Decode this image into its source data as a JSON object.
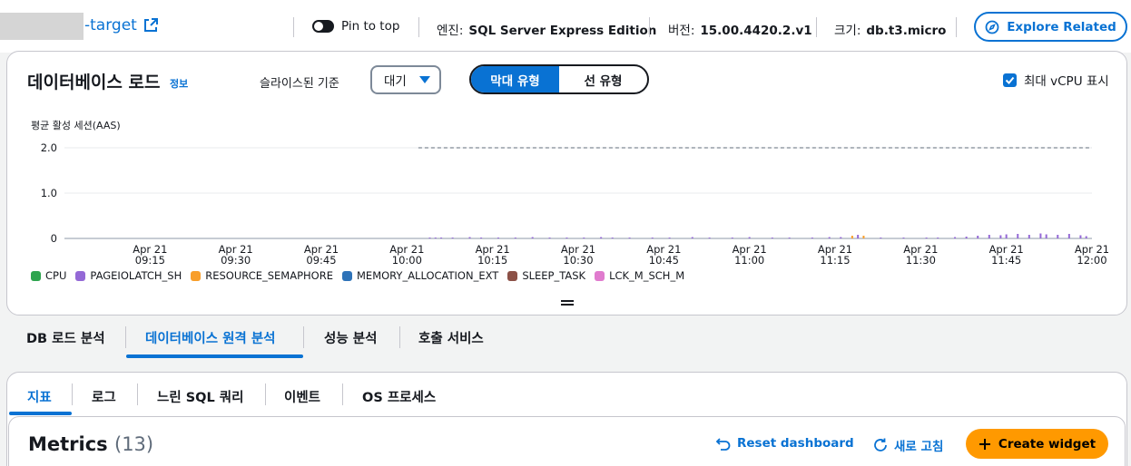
{
  "header": {
    "db_name": "-target",
    "pin_label": "Pin to top",
    "engine_label": "엔진:",
    "engine_value": "SQL Server Express Edition",
    "version_label": "버전:",
    "version_value": "15.00.4420.2.v1",
    "size_label": "크기:",
    "size_value": "db.t3.micro",
    "explore_label": "Explore Related"
  },
  "load_panel": {
    "title": "데이터베이스 로드",
    "info": "정보",
    "slice_label": "슬라이스된 기준",
    "slice_value": "대기",
    "seg_bar": "막대 유형",
    "seg_line": "선 유형",
    "vcpu_label": "최대 vCPU 표시",
    "vcpu_checked": true,
    "y_title": "평균 활성 세션(AAS)"
  },
  "chart_data": {
    "type": "bar",
    "ylabel": "평균 활성 세션(AAS)",
    "ylim": [
      0,
      2.0
    ],
    "yticks": [
      "2.0",
      "1.0",
      "0"
    ],
    "x_ticks": [
      {
        "date": "Apr 21",
        "time": "09:15"
      },
      {
        "date": "Apr 21",
        "time": "09:30"
      },
      {
        "date": "Apr 21",
        "time": "09:45"
      },
      {
        "date": "Apr 21",
        "time": "10:00"
      },
      {
        "date": "Apr 21",
        "time": "10:15"
      },
      {
        "date": "Apr 21",
        "time": "10:30"
      },
      {
        "date": "Apr 21",
        "time": "10:45"
      },
      {
        "date": "Apr 21",
        "time": "11:00"
      },
      {
        "date": "Apr 21",
        "time": "11:15"
      },
      {
        "date": "Apr 21",
        "time": "11:30"
      },
      {
        "date": "Apr 21",
        "time": "11:45"
      },
      {
        "date": "Apr 21",
        "time": "12:00"
      }
    ],
    "x_range_minutes": [
      0,
      180
    ],
    "max_vcpu": {
      "value": 2.0,
      "start_minute": 62
    },
    "series": [
      {
        "name": "CPU",
        "color": "#2ea44f"
      },
      {
        "name": "PAGEIOLATCH_SH",
        "color": "#9469d6"
      },
      {
        "name": "RESOURCE_SEMAPHORE",
        "color": "#f89e2a"
      },
      {
        "name": "MEMORY_ALLOCATION_EXT",
        "color": "#2e73b8"
      },
      {
        "name": "SLEEP_TASK",
        "color": "#8c5147"
      },
      {
        "name": "LCK_M_SCH_M",
        "color": "#e07bce"
      }
    ],
    "bars": [
      [
        64,
        0.02
      ],
      [
        65,
        0.02
      ],
      [
        66,
        0.02
      ],
      [
        68,
        0.02
      ],
      [
        71,
        0.03
      ],
      [
        73,
        0.02
      ],
      [
        76,
        0.02
      ],
      [
        79,
        0.02
      ],
      [
        82,
        0.03
      ],
      [
        85,
        0.02
      ],
      [
        88,
        0.02
      ],
      [
        91,
        0.02
      ],
      [
        94,
        0.03
      ],
      [
        96,
        0.02
      ],
      [
        99,
        0.02
      ],
      [
        103,
        0.02
      ],
      [
        106,
        0.02
      ],
      [
        110,
        0.03
      ],
      [
        113,
        0.02
      ],
      [
        117,
        0.02
      ],
      [
        120,
        0.03
      ],
      [
        124,
        0.02
      ],
      [
        127,
        0.02
      ],
      [
        131,
        0.02
      ],
      [
        134,
        0.03
      ],
      [
        136,
        0.03
      ],
      [
        138,
        0.06
      ],
      [
        139,
        0.08
      ],
      [
        140,
        0.06
      ],
      [
        143,
        0.02
      ],
      [
        147,
        0.02
      ],
      [
        151,
        0.02
      ],
      [
        153,
        0.02
      ],
      [
        156,
        0.03
      ],
      [
        158,
        0.04
      ],
      [
        160,
        0.06
      ],
      [
        162,
        0.08
      ],
      [
        164,
        0.07
      ],
      [
        165,
        0.09
      ],
      [
        167,
        0.1
      ],
      [
        169,
        0.08
      ],
      [
        171,
        0.11
      ],
      [
        172,
        0.09
      ],
      [
        174,
        0.08
      ],
      [
        176,
        0.1
      ],
      [
        178,
        0.07
      ],
      [
        179,
        0.05
      ]
    ]
  },
  "tabs_main": {
    "t1": "DB 로드 분석",
    "t2": "데이터베이스 원격 분석",
    "t3": "성능 분석",
    "t4": "호출 서비스"
  },
  "tabs_sub": {
    "t1": "지표",
    "t2": "로그",
    "t3": "느린 SQL 쿼리",
    "t4": "이벤트",
    "t5": "OS 프로세스"
  },
  "metrics": {
    "title": "Metrics",
    "count": "(13)",
    "reset": "Reset dashboard",
    "refresh": "새로 고침",
    "create": "Create widget"
  }
}
